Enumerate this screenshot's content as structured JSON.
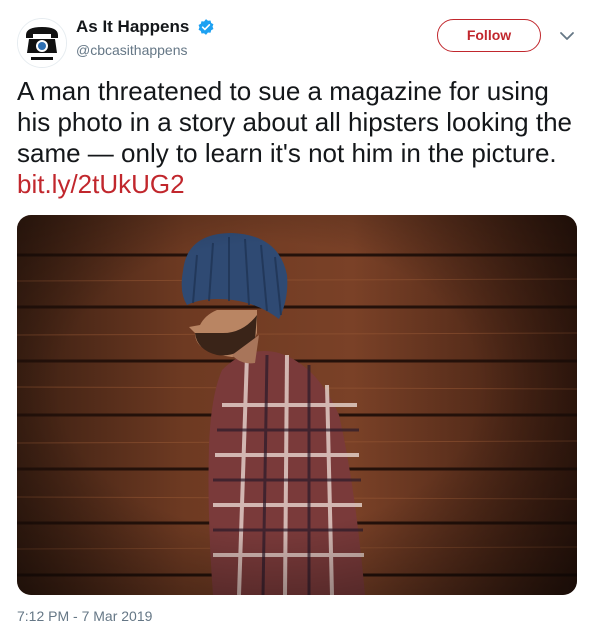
{
  "account": {
    "display_name": "As It Happens",
    "handle": "@cbcasithappens",
    "verified": true,
    "avatar": "radio-logo-avatar"
  },
  "follow_label": "Follow",
  "tweet": {
    "text": "A man threatened to sue a magazine for using his photo in a story about all hipsters looking the same — only to learn it's not him in the picture.",
    "link": "bit.ly/2tUkUG2"
  },
  "media": {
    "description": "hipster-photo"
  },
  "timestamp": "7:12 PM - 7 Mar 2019",
  "icons": {
    "verified": "verified-badge-icon",
    "more": "chevron-down-icon"
  },
  "colors": {
    "accent": "#c1272d",
    "verified": "#1da1f2",
    "secondary_text": "#657786",
    "text": "#14171a"
  }
}
